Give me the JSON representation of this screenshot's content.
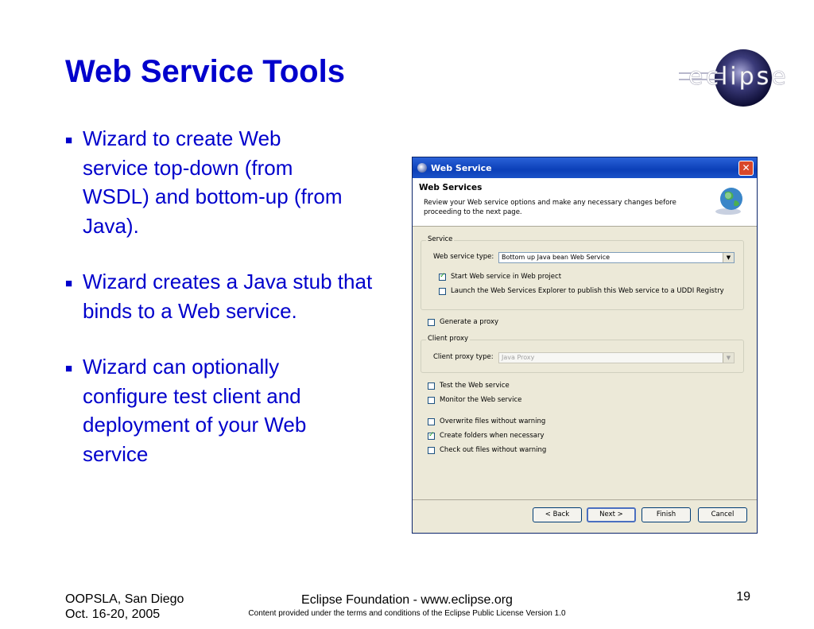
{
  "slide": {
    "title": "Web Service Tools",
    "bullets": [
      "Wizard to create Web service top-down (from WSDL) and bottom-up (from Java).",
      "Wizard creates a Java stub that binds to a Web service.",
      "Wizard can optionally configure test client and deployment of your Web service"
    ],
    "bullet_mark": "■",
    "logo_text": "eclipse"
  },
  "dialog": {
    "window_title": "Web Service",
    "close_glyph": "✕",
    "banner_title": "Web Services",
    "banner_description": "Review your Web service options and make any necessary changes before proceeding to the next page.",
    "service_group": "Service",
    "service_type_label": "Web service type:",
    "service_type_value": "Bottom up Java bean Web Service",
    "start_service_label": "Start Web service in Web project",
    "start_service_checked": true,
    "launch_explorer_label": "Launch the Web Services Explorer to publish this Web service to a UDDI Registry",
    "launch_explorer_checked": false,
    "generate_proxy_label": "Generate a proxy",
    "generate_proxy_checked": false,
    "client_group": "Client proxy",
    "client_type_label": "Client proxy type:",
    "client_type_value": "Java Proxy",
    "test_service_label": "Test the Web service",
    "test_service_checked": false,
    "monitor_service_label": "Monitor the Web service",
    "monitor_service_checked": false,
    "overwrite_label": "Overwrite files without warning",
    "overwrite_checked": false,
    "create_folders_label": "Create folders when necessary",
    "create_folders_checked": true,
    "checkout_label": "Check out files without warning",
    "checkout_checked": false,
    "buttons": {
      "back": "< Back",
      "next": "Next >",
      "finish": "Finish",
      "cancel": "Cancel"
    },
    "combo_arrow": "▼"
  },
  "footer": {
    "left_line1": "OOPSLA, San Diego",
    "left_line2": "Oct. 16-20, 2005",
    "center_line1": "Eclipse Foundation - www.eclipse.org",
    "center_line2": "Content provided under the terms and conditions of the Eclipse Public License Version 1.0",
    "page_number": "19"
  },
  "colors": {
    "title": "#0000cc",
    "titlebar": "#0b3fb8",
    "dialog_bg": "#ece9d8"
  }
}
